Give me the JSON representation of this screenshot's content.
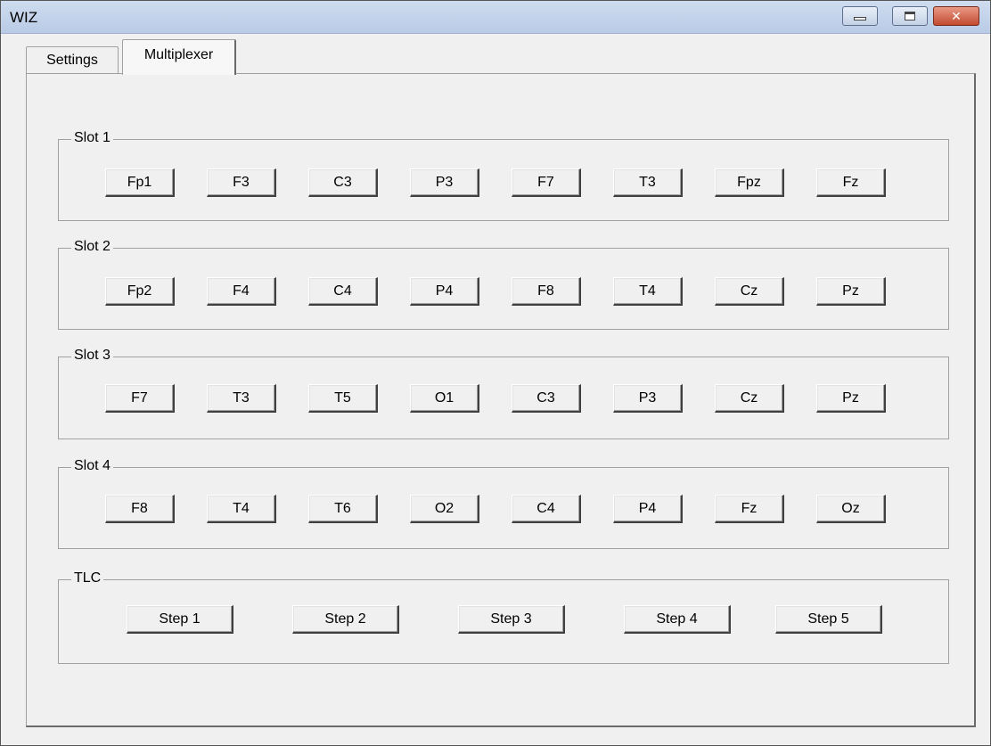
{
  "window": {
    "title": "WIZ",
    "controls": {
      "minimize": "minimize",
      "maximize": "maximize",
      "close": "✕"
    }
  },
  "tabs": [
    {
      "label": "Settings",
      "active": false
    },
    {
      "label": "Multiplexer",
      "active": true
    }
  ],
  "slots": [
    {
      "label": "Slot 1",
      "channels": [
        "Fp1",
        "F3",
        "C3",
        "P3",
        "F7",
        "T3",
        "Fpz",
        "Fz"
      ]
    },
    {
      "label": "Slot 2",
      "channels": [
        "Fp2",
        "F4",
        "C4",
        "P4",
        "F8",
        "T4",
        "Cz",
        "Pz"
      ]
    },
    {
      "label": "Slot 3",
      "channels": [
        "F7",
        "T3",
        "T5",
        "O1",
        "C3",
        "P3",
        "Cz",
        "Pz"
      ]
    },
    {
      "label": "Slot 4",
      "channels": [
        "F8",
        "T4",
        "T6",
        "O2",
        "C4",
        "P4",
        "Fz",
        "Oz"
      ]
    }
  ],
  "tlc": {
    "label": "TLC",
    "steps": [
      "Step 1",
      "Step 2",
      "Step 3",
      "Step 4",
      "Step 5"
    ]
  }
}
